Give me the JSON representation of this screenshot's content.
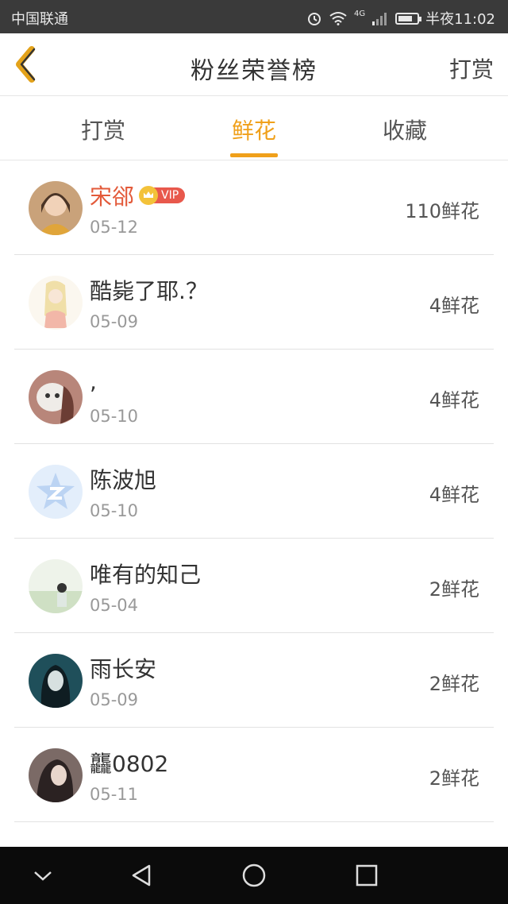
{
  "status_bar": {
    "carrier": "中国联通",
    "network": "4G",
    "time": "半夜11:02",
    "battery_level": 0.75
  },
  "header": {
    "title": "粉丝荣誉榜",
    "action_label": "打赏"
  },
  "tabs": [
    {
      "label": "打赏",
      "active": false
    },
    {
      "label": "鲜花",
      "active": true
    },
    {
      "label": "收藏",
      "active": false
    }
  ],
  "colors": {
    "accent": "#f0a01a",
    "vip_name": "#e35a3a"
  },
  "fans": [
    {
      "name": "宋郤",
      "vip": true,
      "vip_label": "VIP",
      "date": "05-12",
      "flowers": "110鲜花"
    },
    {
      "name": "酷毙了耶.？",
      "vip": false,
      "date": "05-09",
      "flowers": "4鲜花"
    },
    {
      "name": ",",
      "vip": false,
      "date": "05-10",
      "flowers": "4鲜花"
    },
    {
      "name": "陈波旭",
      "vip": false,
      "date": "05-10",
      "flowers": "4鲜花"
    },
    {
      "name": "唯有的知己",
      "vip": false,
      "date": "05-04",
      "flowers": "2鲜花"
    },
    {
      "name": "雨长安",
      "vip": false,
      "date": "05-09",
      "flowers": "2鲜花"
    },
    {
      "name": "龘0802",
      "vip": false,
      "date": "05-11",
      "flowers": "2鲜花"
    }
  ]
}
